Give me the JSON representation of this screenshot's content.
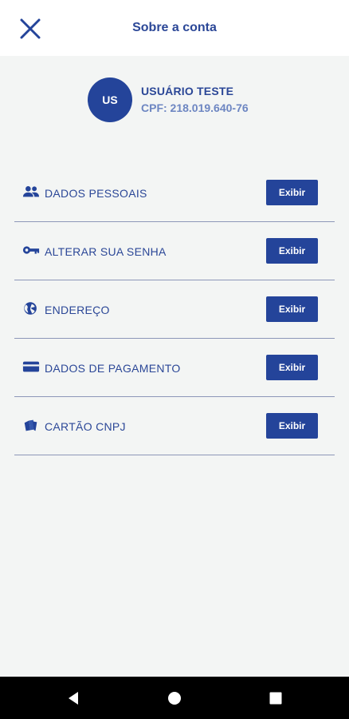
{
  "header": {
    "title": "Sobre a conta",
    "close_icon": "close-icon"
  },
  "profile": {
    "initials": "US",
    "name": "USUÁRIO TESTE",
    "cpf": "CPF: 218.019.640-76"
  },
  "menu": {
    "items": [
      {
        "label": "DADOS PESSOAIS",
        "icon": "people-icon",
        "button": "Exibir"
      },
      {
        "label": "ALTERAR SUA SENHA",
        "icon": "key-icon",
        "button": "Exibir"
      },
      {
        "label": "ENDEREÇO",
        "icon": "globe-icon",
        "button": "Exibir"
      },
      {
        "label": "DADOS DE PAGAMENTO",
        "icon": "credit-card-icon",
        "button": "Exibir"
      },
      {
        "label": "CARTÃO CNPJ",
        "icon": "cards-icon",
        "button": "Exibir"
      }
    ]
  },
  "navbar": {
    "back_icon": "back-icon",
    "home_icon": "home-icon",
    "recents_icon": "recents-icon"
  },
  "colors": {
    "primary": "#24449a",
    "text": "#2b4797",
    "secondary_text": "#6d86c2",
    "background": "#f3f5f4"
  }
}
